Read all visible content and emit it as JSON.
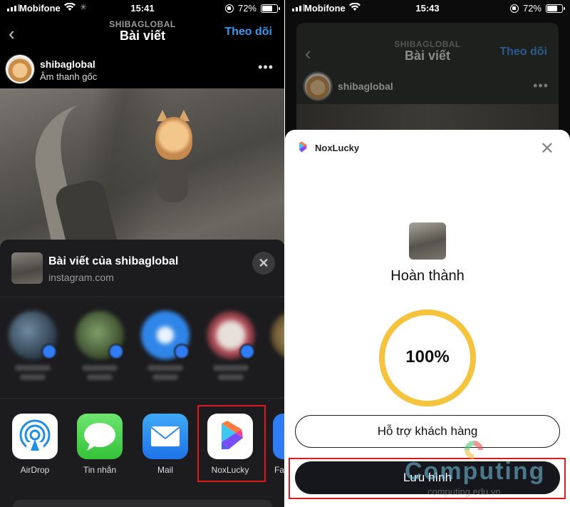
{
  "left": {
    "status": {
      "carrier": "Mobifone",
      "time": "15:41",
      "battery": "72%",
      "battery_level": 0.72
    },
    "header": {
      "subtitle": "SHIBAGLOBAL",
      "title": "Bài viết",
      "follow_label": "Theo dõi"
    },
    "post": {
      "username": "shibaglobal",
      "audio": "Âm thanh gốc"
    },
    "share_sheet": {
      "title": "Bài viết của shibaglobal",
      "url": "instagram.com",
      "close_icon": "close-icon",
      "contacts_count_note": null,
      "apps": [
        {
          "label": "AirDrop",
          "icon": "airdrop-icon"
        },
        {
          "label": "Tin nhắn",
          "icon": "messages-icon"
        },
        {
          "label": "Mail",
          "icon": "mail-icon"
        },
        {
          "label": "NoxLucky",
          "icon": "noxlucky-icon"
        },
        {
          "label": "Fa",
          "icon": "facebook-icon"
        }
      ]
    }
  },
  "right": {
    "status": {
      "carrier": "Mobifone",
      "time": "15:43",
      "battery": "72%",
      "battery_level": 0.72
    },
    "header": {
      "subtitle": "SHIBAGLOBAL",
      "title": "Bài viết",
      "follow_label": "Theo dõi"
    },
    "post": {
      "username": "shibaglobal"
    },
    "modal": {
      "app_name": "NoxLucky",
      "status": "Hoàn thành",
      "progress_label": "100%",
      "progress_value": 1.0,
      "support_button": "Hỗ trợ khách hàng",
      "save_button": "Lưu hình"
    }
  },
  "watermark": {
    "brand": "Computing",
    "url": "computing.edu.vn"
  },
  "colors": {
    "accent_blue": "#3897f0",
    "highlight_red": "#e0191e",
    "progress_yellow": "#f6c33d"
  }
}
